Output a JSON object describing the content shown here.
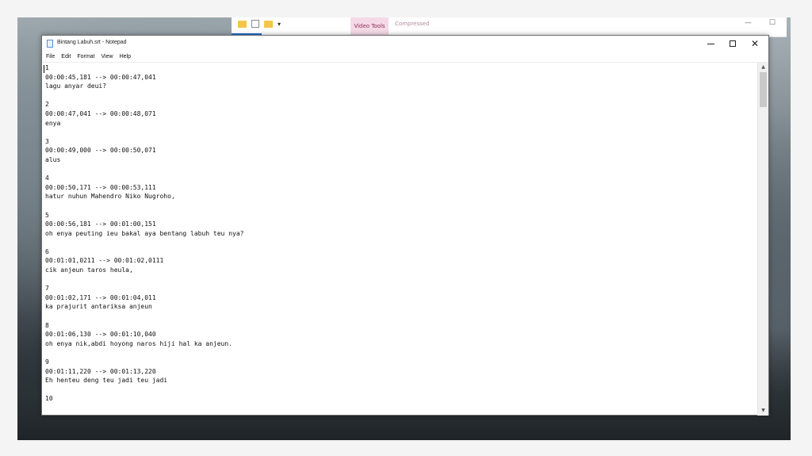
{
  "background_window": {
    "context_tab": "Video Tools",
    "compressed_label": "Compressed"
  },
  "window": {
    "title": "Bintang Labuh.srt - Notepad",
    "minimize_glyph": "—",
    "close_glyph": "✕"
  },
  "menu": [
    "File",
    "Edit",
    "Format",
    "View",
    "Help"
  ],
  "editor_lines": [
    "1",
    "00:00:45,181 --> 00:00:47,041",
    "lagu anyar deui?",
    "",
    "2",
    "00:00:47,041 --> 00:00:48,071",
    "enya",
    "",
    "3",
    "00:00:49,000 --> 00:00:50,071",
    "alus",
    "",
    "4",
    "00:00:50,171 --> 00:00:53,111",
    "hatur nuhun Mahendro Niko Nugroho,",
    "",
    "5",
    "00:00:56,181 --> 00:01:00,151",
    "oh enya peuting ieu bakal aya bentang labuh teu nya?",
    "",
    "6",
    "00:01:01,0211 --> 00:01:02,0111",
    "cik anjeun taros heula,",
    "",
    "7",
    "00:01:02,171 --> 00:01:04,011",
    "ka prajurit antariksa anjeun",
    "",
    "8",
    "00:01:06,130 --> 00:01:10,040",
    "oh enya nik,abdi hoyong naros hiji hal ka anjeun.",
    "",
    "9",
    "00:01:11,220 --> 00:01:13,220",
    "Eh henteu deng teu jadi teu jadi",
    "",
    "10"
  ],
  "icons": {
    "app": "notepad-icon",
    "scroll_up": "chevron-up-icon",
    "scroll_down": "chevron-down-icon"
  },
  "scrollbar": {
    "position_fraction": 0.0
  }
}
